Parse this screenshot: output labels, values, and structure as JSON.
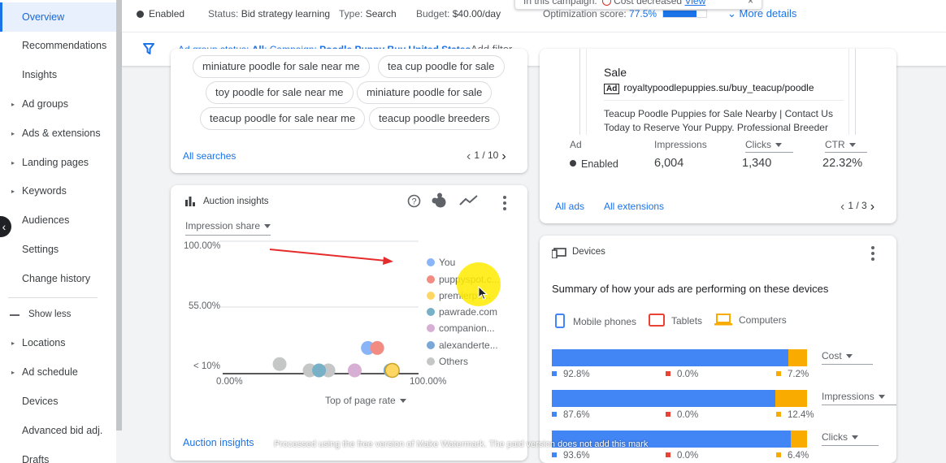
{
  "sidebar": {
    "items": [
      {
        "label": "Overview",
        "active": true,
        "caret": false
      },
      {
        "label": "Recommendations",
        "caret": false
      },
      {
        "label": "Insights",
        "caret": false
      },
      {
        "label": "Ad groups",
        "caret": true
      },
      {
        "label": "Ads & extensions",
        "caret": true
      },
      {
        "label": "Landing pages",
        "caret": true
      },
      {
        "label": "Keywords",
        "caret": true
      },
      {
        "label": "Audiences",
        "caret": false
      },
      {
        "label": "Settings",
        "caret": false
      },
      {
        "label": "Change history",
        "caret": false
      }
    ],
    "show_less": "Show less",
    "items2": [
      {
        "label": "Locations",
        "caret": true
      },
      {
        "label": "Ad schedule",
        "caret": true
      },
      {
        "label": "Devices",
        "caret": false
      },
      {
        "label": "Advanced bid adj.",
        "caret": false
      },
      {
        "label": "Drafts",
        "caret": false
      }
    ]
  },
  "status_bar": {
    "enabled": "Enabled",
    "status_label": "Status:",
    "status_value": "Bid strategy learning",
    "type_label": "Type:",
    "type_value": "Search",
    "budget_label": "Budget:",
    "budget_value": "$40.00/day",
    "opt_label": "Optimization score:",
    "opt_value": "77.5%",
    "opt_fraction": 0.775,
    "more_details": "More details"
  },
  "notification": {
    "prefix": "In this campaign:",
    "message": "Cost decreased",
    "link": "View",
    "close": "×"
  },
  "filter_bar": {
    "status_label": "Ad group status: ",
    "status_value": "All",
    "campaign_label": "; Campaign: ",
    "campaign_value": "Poodle Puppy Buy United States",
    "add_filter": "Add filter"
  },
  "searches": {
    "chips": [
      "miniature poodle for sale near me",
      "tea cup poodle for sale",
      "toy poodle for sale near me",
      "miniature poodle for sale",
      "teacup poodle for sale near me",
      "teacup poodle breeders"
    ],
    "all_link": "All searches",
    "pager": "1 / 10"
  },
  "auction": {
    "title": "Auction insights",
    "metric": "Impression share",
    "x_axis_select": "Top of page rate",
    "link": "Auction insights",
    "legend": [
      {
        "name": "You",
        "color": "#8ab4f8"
      },
      {
        "name": "puppyspot.c...",
        "color": "#f28b82"
      },
      {
        "name": "premierpu...",
        "color": "#fdd663"
      },
      {
        "name": "pawrade.com",
        "color": "#78b0c8"
      },
      {
        "name": "companion...",
        "color": "#d7aed4"
      },
      {
        "name": "alexanderte...",
        "color": "#7aa6d8"
      },
      {
        "name": "Others",
        "color": "#c4c7c5"
      }
    ]
  },
  "chart_data": {
    "type": "scatter",
    "x_ticks": [
      "0.00%",
      "100.00%"
    ],
    "y_ticks": [
      "100.00%",
      "55.00%",
      "< 10%"
    ],
    "xlim": [
      0,
      100
    ],
    "ylim": [
      10,
      100
    ],
    "series": [
      {
        "name": "You",
        "color": "#8ab4f8",
        "points": [
          [
            73,
            27
          ]
        ]
      },
      {
        "name": "puppyspot.c...",
        "color": "#f28b82",
        "points": [
          [
            78,
            27
          ]
        ]
      },
      {
        "name": "premierpu...",
        "color": "#fdd663",
        "points": [
          [
            86,
            10
          ]
        ]
      },
      {
        "name": "pawrade.com",
        "color": "#78b0c8",
        "points": [
          [
            47,
            10
          ]
        ]
      },
      {
        "name": "companion...",
        "color": "#d7aed4",
        "points": [
          [
            66,
            10
          ]
        ]
      },
      {
        "name": "alexanderte...",
        "color": "#7aa6d8",
        "points": [
          [
            85,
            10
          ]
        ]
      },
      {
        "name": "Others",
        "color": "#c4c7c5",
        "points": [
          [
            26,
            16
          ],
          [
            42,
            10
          ],
          [
            52,
            10
          ],
          [
            86,
            10
          ]
        ]
      }
    ]
  },
  "ad": {
    "headline": "Sale",
    "ad_tag": "Ad",
    "url": "royaltypoodlepuppies.su/buy_teacup/poodle",
    "description": "Teacup Poodle Puppies for Sale Nearby | Contact Us Today to Reserve Your Puppy. Professional Breeder",
    "metrics": {
      "ad_label": "Ad",
      "ad_value": "Enabled",
      "impressions_label": "Impressions",
      "impressions_value": "6,004",
      "clicks_label": "Clicks",
      "clicks_value": "1,340",
      "ctr_label": "CTR",
      "ctr_value": "22.32%"
    },
    "all_ads": "All ads",
    "all_extensions": "All extensions",
    "pager": "1 / 3"
  },
  "devices": {
    "title": "Devices",
    "summary": "Summary of how your ads are performing on these devices",
    "legend": [
      {
        "name": "Mobile phones",
        "color": "#4285f4"
      },
      {
        "name": "Tablets",
        "color": "#ea4335"
      },
      {
        "name": "Computers",
        "color": "#f9ab00"
      }
    ],
    "bars": [
      {
        "metric": "Cost",
        "mobile": "92.8%",
        "tablet": "0.0%",
        "computer": "7.2%",
        "mobile_pct": 92.8,
        "tablet_pct": 0.0,
        "computer_pct": 7.2
      },
      {
        "metric": "Impressions",
        "mobile": "87.6%",
        "tablet": "0.0%",
        "computer": "12.4%",
        "mobile_pct": 87.6,
        "tablet_pct": 0.0,
        "computer_pct": 12.4
      },
      {
        "metric": "Clicks",
        "mobile": "93.6%",
        "tablet": "0.0%",
        "computer": "6.4%",
        "mobile_pct": 93.6,
        "tablet_pct": 0.0,
        "computer_pct": 6.4
      }
    ]
  },
  "watermark": "Processed using the free version of Make Watermark. The paid version does not add this mark"
}
